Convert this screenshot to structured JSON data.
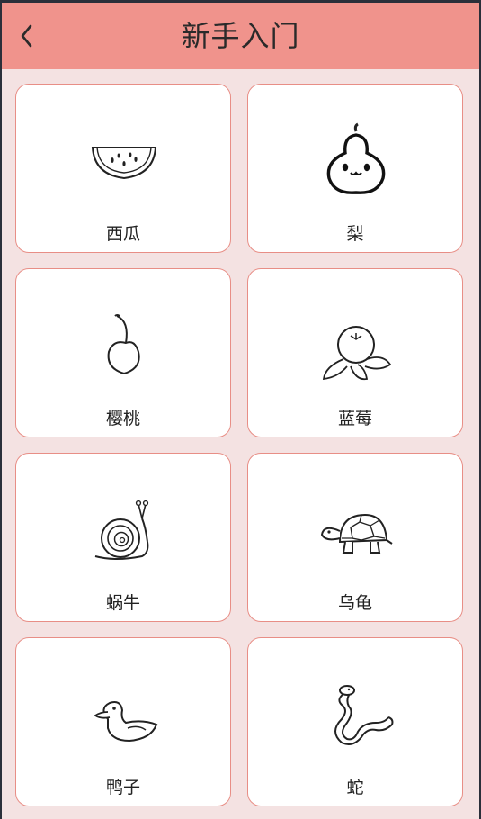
{
  "header": {
    "title": "新手入门",
    "back_icon": "chevron-left-icon"
  },
  "items": [
    {
      "label": "西瓜",
      "icon": "watermelon-icon"
    },
    {
      "label": "梨",
      "icon": "pear-icon"
    },
    {
      "label": "樱桃",
      "icon": "cherry-icon"
    },
    {
      "label": "蓝莓",
      "icon": "blueberry-icon"
    },
    {
      "label": "蜗牛",
      "icon": "snail-icon"
    },
    {
      "label": "乌龟",
      "icon": "turtle-icon"
    },
    {
      "label": "鸭子",
      "icon": "duck-icon"
    },
    {
      "label": "蛇",
      "icon": "snake-icon"
    }
  ],
  "colors": {
    "header": "#f0938c",
    "background": "#f4e2e2",
    "card_border": "#e88e86",
    "card": "#ffffff"
  }
}
